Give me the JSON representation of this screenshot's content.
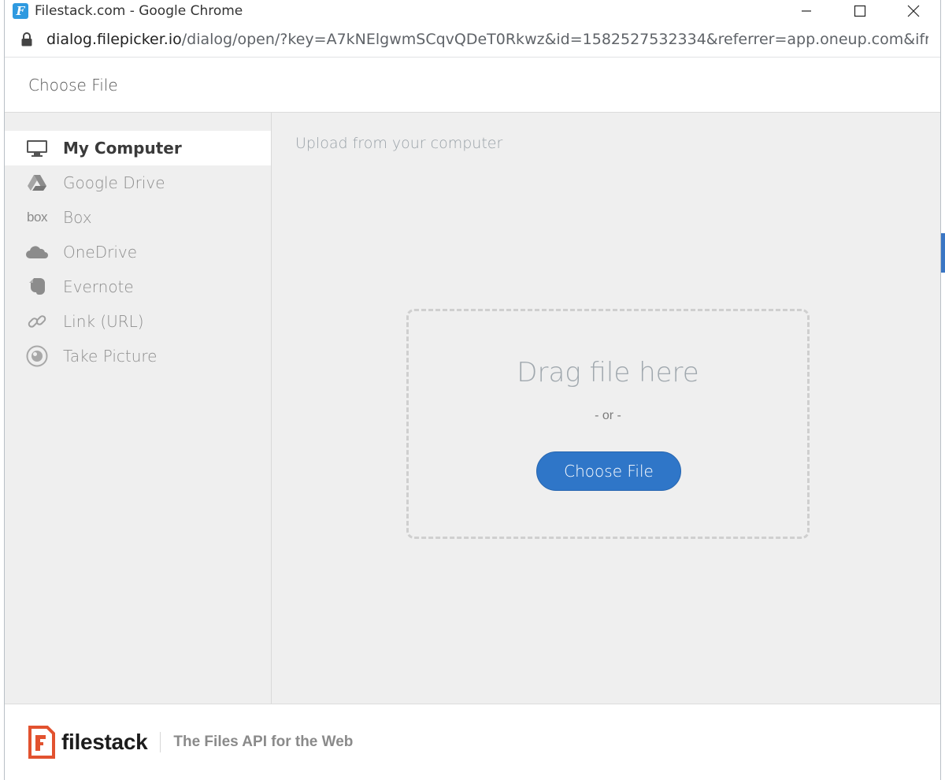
{
  "browser": {
    "title": "Filestack.com - Google Chrome",
    "app_icon_letter": "F",
    "url_host": "dialog.filepicker.io",
    "url_path": "/dialog/open/?key=A7kNElgwmSCqvQDeT0Rkwz&id=1582527532334&referrer=app.oneup.com&ifra..."
  },
  "dialog": {
    "title": "Choose File"
  },
  "sidebar": {
    "items": [
      {
        "label": "My Computer",
        "icon": "monitor-icon",
        "active": true
      },
      {
        "label": "Google Drive",
        "icon": "google-drive-icon",
        "active": false
      },
      {
        "label": "Box",
        "icon": "box-icon",
        "icon_text": "box",
        "active": false
      },
      {
        "label": "OneDrive",
        "icon": "onedrive-icon",
        "active": false
      },
      {
        "label": "Evernote",
        "icon": "evernote-icon",
        "active": false
      },
      {
        "label": "Link (URL)",
        "icon": "link-icon",
        "active": false
      },
      {
        "label": "Take Picture",
        "icon": "camera-icon",
        "active": false
      }
    ]
  },
  "main": {
    "heading": "Upload from your computer",
    "drag_text": "Drag file here",
    "or_text": "- or -",
    "choose_button": "Choose File"
  },
  "footer": {
    "brand": "filestack",
    "tagline": "The Files API for the Web"
  },
  "colors": {
    "accent": "#2f76c8",
    "brand": "#e2522f"
  }
}
